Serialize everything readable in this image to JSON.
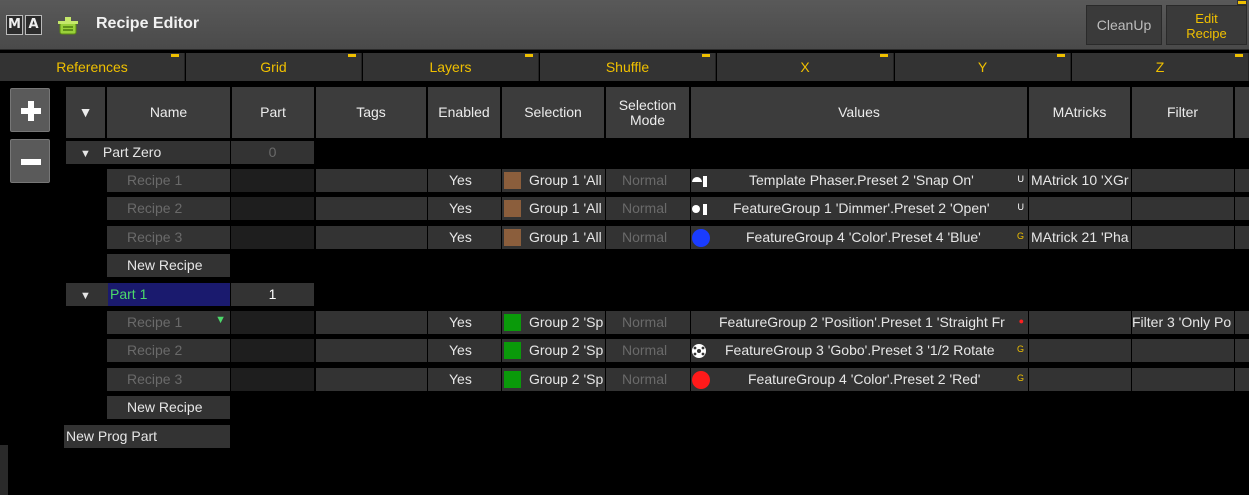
{
  "window": {
    "logo_letters": [
      "M",
      "A"
    ],
    "title": "Recipe Editor",
    "cleanup_label": "CleanUp",
    "edit_recipe_label_line1": "Edit",
    "edit_recipe_label_line2": "Recipe"
  },
  "tabs": [
    {
      "label": "References",
      "x": 0
    },
    {
      "label": "Grid"
    },
    {
      "label": "Layers"
    },
    {
      "label": "Shuffle"
    },
    {
      "label": "X"
    },
    {
      "label": "Y"
    },
    {
      "label": "Z"
    }
  ],
  "columns": {
    "name": "Name",
    "part": "Part",
    "tags": "Tags",
    "enabled": "Enabled",
    "selection": "Selection",
    "selection_mode_line1": "Selection",
    "selection_mode_line2": "Mode",
    "values": "Values",
    "matricks": "MAtricks",
    "filter": "Filter"
  },
  "parts": [
    {
      "name": "Part Zero",
      "part_no": "0",
      "recipes": [
        {
          "name": "Recipe 1",
          "enabled": "Yes",
          "selection": "Group 1 'All",
          "mode": "Normal",
          "value": "Template Phaser.Preset 2 'Snap On'",
          "value_flag": "U",
          "matricks": "MAtrick 10 'XGr",
          "filter": ""
        },
        {
          "name": "Recipe 2",
          "enabled": "Yes",
          "selection": "Group 1 'All",
          "mode": "Normal",
          "value": "FeatureGroup 1 'Dimmer'.Preset 2 'Open'",
          "value_flag": "U",
          "matricks": "",
          "filter": ""
        },
        {
          "name": "Recipe 3",
          "enabled": "Yes",
          "selection": "Group 1 'All",
          "mode": "Normal",
          "value": "FeatureGroup 4 'Color'.Preset 4 'Blue'",
          "value_flag": "G",
          "matricks": "MAtrick 21 'Pha",
          "filter": ""
        }
      ],
      "new_recipe": "New Recipe"
    },
    {
      "name": "Part 1",
      "part_no": "1",
      "recipes": [
        {
          "name": "Recipe 1",
          "enabled": "Yes",
          "selection": "Group 2 'Sp",
          "mode": "Normal",
          "value": "FeatureGroup 2 'Position'.Preset 1 'Straight Fr",
          "value_flag": "",
          "matricks": "",
          "filter": "Filter 3 'Only Po"
        },
        {
          "name": "Recipe 2",
          "enabled": "Yes",
          "selection": "Group 2 'Sp",
          "mode": "Normal",
          "value": "FeatureGroup 3 'Gobo'.Preset 3 '1/2 Rotate",
          "value_flag": "G",
          "matricks": "",
          "filter": ""
        },
        {
          "name": "Recipe 3",
          "enabled": "Yes",
          "selection": "Group 2 'Sp",
          "mode": "Normal",
          "value": "FeatureGroup 4 'Color'.Preset 2 'Red'",
          "value_flag": "G",
          "matricks": "",
          "filter": ""
        }
      ],
      "new_recipe": "New Recipe"
    }
  ],
  "new_prog_part": "New Prog Part",
  "colors": {
    "accent_yellow": "#f0c000",
    "group1_swatch": "#8b5e3c",
    "group2_swatch": "#0a9a0a",
    "blue_dot": "#1a3cff",
    "red_dot": "#ff1a1a",
    "selected_part_bg": "#1a1a6e",
    "selected_part_text": "#4cd96a"
  }
}
